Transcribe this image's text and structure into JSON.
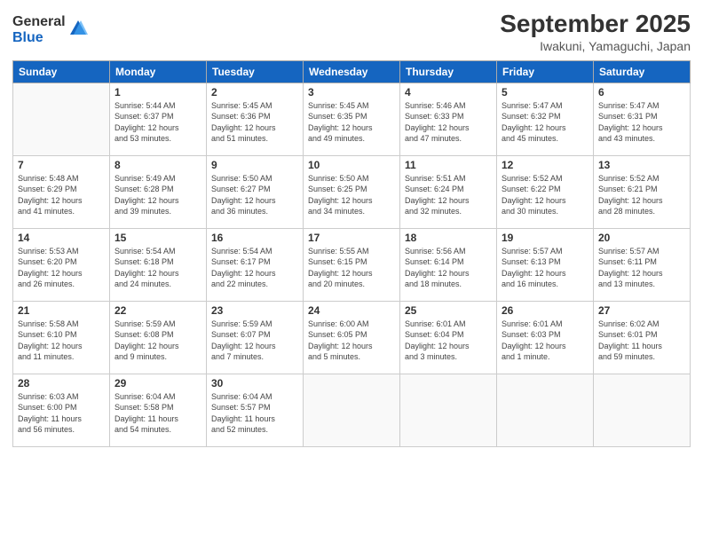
{
  "logo": {
    "general": "General",
    "blue": "Blue"
  },
  "title": {
    "month": "September 2025",
    "location": "Iwakuni, Yamaguchi, Japan"
  },
  "headers": [
    "Sunday",
    "Monday",
    "Tuesday",
    "Wednesday",
    "Thursday",
    "Friday",
    "Saturday"
  ],
  "weeks": [
    [
      {
        "day": "",
        "info": ""
      },
      {
        "day": "1",
        "info": "Sunrise: 5:44 AM\nSunset: 6:37 PM\nDaylight: 12 hours\nand 53 minutes."
      },
      {
        "day": "2",
        "info": "Sunrise: 5:45 AM\nSunset: 6:36 PM\nDaylight: 12 hours\nand 51 minutes."
      },
      {
        "day": "3",
        "info": "Sunrise: 5:45 AM\nSunset: 6:35 PM\nDaylight: 12 hours\nand 49 minutes."
      },
      {
        "day": "4",
        "info": "Sunrise: 5:46 AM\nSunset: 6:33 PM\nDaylight: 12 hours\nand 47 minutes."
      },
      {
        "day": "5",
        "info": "Sunrise: 5:47 AM\nSunset: 6:32 PM\nDaylight: 12 hours\nand 45 minutes."
      },
      {
        "day": "6",
        "info": "Sunrise: 5:47 AM\nSunset: 6:31 PM\nDaylight: 12 hours\nand 43 minutes."
      }
    ],
    [
      {
        "day": "7",
        "info": "Sunrise: 5:48 AM\nSunset: 6:29 PM\nDaylight: 12 hours\nand 41 minutes."
      },
      {
        "day": "8",
        "info": "Sunrise: 5:49 AM\nSunset: 6:28 PM\nDaylight: 12 hours\nand 39 minutes."
      },
      {
        "day": "9",
        "info": "Sunrise: 5:50 AM\nSunset: 6:27 PM\nDaylight: 12 hours\nand 36 minutes."
      },
      {
        "day": "10",
        "info": "Sunrise: 5:50 AM\nSunset: 6:25 PM\nDaylight: 12 hours\nand 34 minutes."
      },
      {
        "day": "11",
        "info": "Sunrise: 5:51 AM\nSunset: 6:24 PM\nDaylight: 12 hours\nand 32 minutes."
      },
      {
        "day": "12",
        "info": "Sunrise: 5:52 AM\nSunset: 6:22 PM\nDaylight: 12 hours\nand 30 minutes."
      },
      {
        "day": "13",
        "info": "Sunrise: 5:52 AM\nSunset: 6:21 PM\nDaylight: 12 hours\nand 28 minutes."
      }
    ],
    [
      {
        "day": "14",
        "info": "Sunrise: 5:53 AM\nSunset: 6:20 PM\nDaylight: 12 hours\nand 26 minutes."
      },
      {
        "day": "15",
        "info": "Sunrise: 5:54 AM\nSunset: 6:18 PM\nDaylight: 12 hours\nand 24 minutes."
      },
      {
        "day": "16",
        "info": "Sunrise: 5:54 AM\nSunset: 6:17 PM\nDaylight: 12 hours\nand 22 minutes."
      },
      {
        "day": "17",
        "info": "Sunrise: 5:55 AM\nSunset: 6:15 PM\nDaylight: 12 hours\nand 20 minutes."
      },
      {
        "day": "18",
        "info": "Sunrise: 5:56 AM\nSunset: 6:14 PM\nDaylight: 12 hours\nand 18 minutes."
      },
      {
        "day": "19",
        "info": "Sunrise: 5:57 AM\nSunset: 6:13 PM\nDaylight: 12 hours\nand 16 minutes."
      },
      {
        "day": "20",
        "info": "Sunrise: 5:57 AM\nSunset: 6:11 PM\nDaylight: 12 hours\nand 13 minutes."
      }
    ],
    [
      {
        "day": "21",
        "info": "Sunrise: 5:58 AM\nSunset: 6:10 PM\nDaylight: 12 hours\nand 11 minutes."
      },
      {
        "day": "22",
        "info": "Sunrise: 5:59 AM\nSunset: 6:08 PM\nDaylight: 12 hours\nand 9 minutes."
      },
      {
        "day": "23",
        "info": "Sunrise: 5:59 AM\nSunset: 6:07 PM\nDaylight: 12 hours\nand 7 minutes."
      },
      {
        "day": "24",
        "info": "Sunrise: 6:00 AM\nSunset: 6:05 PM\nDaylight: 12 hours\nand 5 minutes."
      },
      {
        "day": "25",
        "info": "Sunrise: 6:01 AM\nSunset: 6:04 PM\nDaylight: 12 hours\nand 3 minutes."
      },
      {
        "day": "26",
        "info": "Sunrise: 6:01 AM\nSunset: 6:03 PM\nDaylight: 12 hours\nand 1 minute."
      },
      {
        "day": "27",
        "info": "Sunrise: 6:02 AM\nSunset: 6:01 PM\nDaylight: 11 hours\nand 59 minutes."
      }
    ],
    [
      {
        "day": "28",
        "info": "Sunrise: 6:03 AM\nSunset: 6:00 PM\nDaylight: 11 hours\nand 56 minutes."
      },
      {
        "day": "29",
        "info": "Sunrise: 6:04 AM\nSunset: 5:58 PM\nDaylight: 11 hours\nand 54 minutes."
      },
      {
        "day": "30",
        "info": "Sunrise: 6:04 AM\nSunset: 5:57 PM\nDaylight: 11 hours\nand 52 minutes."
      },
      {
        "day": "",
        "info": ""
      },
      {
        "day": "",
        "info": ""
      },
      {
        "day": "",
        "info": ""
      },
      {
        "day": "",
        "info": ""
      }
    ]
  ]
}
